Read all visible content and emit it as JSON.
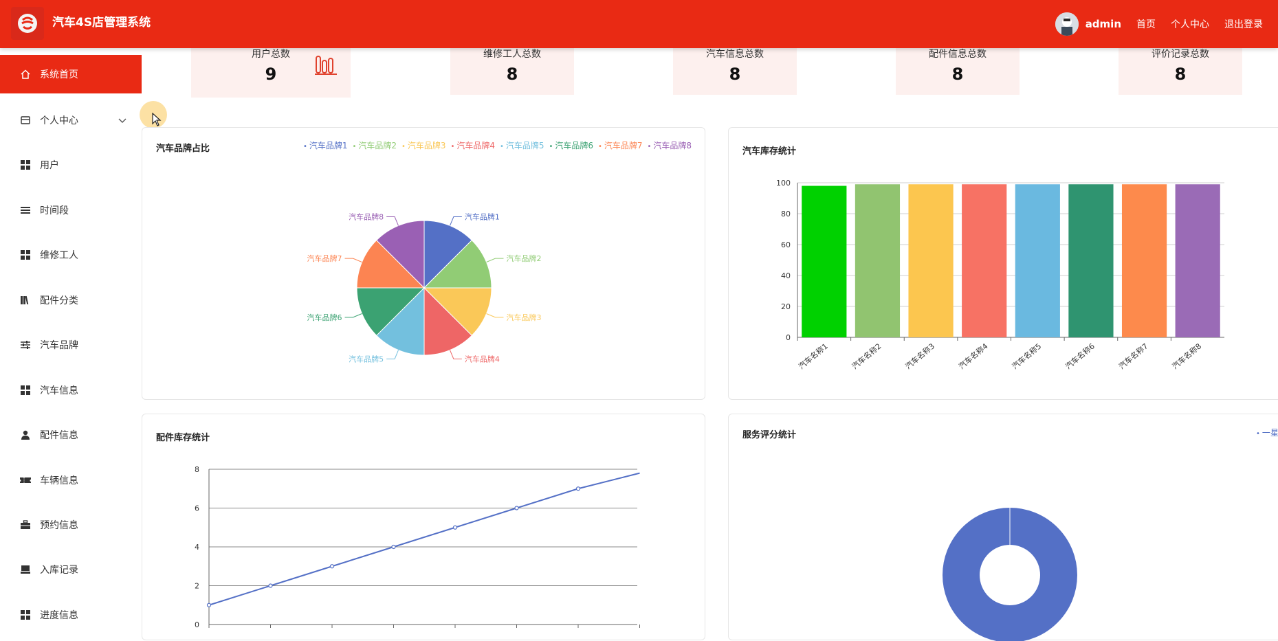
{
  "app": {
    "title": "汽车4S店管理系统",
    "username": "admin",
    "nav_links": [
      "首页",
      "个人中心",
      "退出登录"
    ]
  },
  "sidebar": {
    "items": [
      {
        "label": "系统首页",
        "icon": "home-icon",
        "active": true
      },
      {
        "label": "个人中心",
        "icon": "wallet-icon",
        "expandable": true
      },
      {
        "label": "用户",
        "icon": "grid-icon"
      },
      {
        "label": "时间段",
        "icon": "list-icon"
      },
      {
        "label": "维修工人",
        "icon": "grid-icon"
      },
      {
        "label": "配件分类",
        "icon": "books-icon"
      },
      {
        "label": "汽车品牌",
        "icon": "sliders-icon"
      },
      {
        "label": "汽车信息",
        "icon": "grid-icon"
      },
      {
        "label": "配件信息",
        "icon": "person-icon"
      },
      {
        "label": "车辆信息",
        "icon": "ticket-icon"
      },
      {
        "label": "预约信息",
        "icon": "briefcase-icon"
      },
      {
        "label": "入库记录",
        "icon": "box-icon"
      },
      {
        "label": "进度信息",
        "icon": "grid-icon"
      }
    ]
  },
  "stats": [
    {
      "label": "用户总数",
      "value": "9"
    },
    {
      "label": "维修工人总数",
      "value": "8"
    },
    {
      "label": "汽车信息总数",
      "value": "8"
    },
    {
      "label": "配件信息总数",
      "value": "8"
    },
    {
      "label": "评价记录总数",
      "value": "8"
    }
  ],
  "colors": {
    "accent": "#e92a14",
    "stat_bg": "#fdf0ee",
    "palette": [
      "#5470c6",
      "#91cc75",
      "#fac858",
      "#ee6666",
      "#73c0de",
      "#3ba272",
      "#fc8452",
      "#9a60b4"
    ]
  },
  "chart_data": [
    {
      "type": "pie",
      "title": "汽车品牌占比",
      "categories": [
        "汽车品牌1",
        "汽车品牌2",
        "汽车品牌3",
        "汽车品牌4",
        "汽车品牌5",
        "汽车品牌6",
        "汽车品牌7",
        "汽车品牌8"
      ],
      "values": [
        1,
        1,
        1,
        1,
        1,
        1,
        1,
        1
      ],
      "legend": "top-right"
    },
    {
      "type": "bar",
      "title": "汽车库存统计",
      "categories": [
        "汽车名称1",
        "汽车名称2",
        "汽车名称3",
        "汽车名称4",
        "汽车名称5",
        "汽车名称6",
        "汽车名称7",
        "汽车名称8"
      ],
      "values": [
        98,
        99,
        99,
        99,
        99,
        99,
        99,
        99
      ],
      "bar_colors": [
        "#00d100",
        "#91c470",
        "#fcc64f",
        "#f77264",
        "#6ab9e0",
        "#2f9470",
        "#fd8a4c",
        "#9a6bb6"
      ],
      "ylim": [
        0,
        100
      ],
      "yticks": [
        0,
        20,
        40,
        60,
        80,
        100
      ],
      "grid": true
    },
    {
      "type": "line",
      "title": "配件库存统计",
      "x": [
        1,
        2,
        3,
        4,
        5,
        6,
        7,
        8
      ],
      "y": [
        1,
        2,
        3,
        4,
        5,
        6,
        7,
        7.8
      ],
      "ylim": [
        0,
        8
      ],
      "yticks": [
        0,
        2,
        4,
        6,
        8
      ],
      "grid": true
    },
    {
      "type": "pie",
      "title": "服务评分统计",
      "variant": "donut",
      "categories": [
        "一星"
      ],
      "values": [
        1
      ],
      "legend": "top-right"
    }
  ]
}
